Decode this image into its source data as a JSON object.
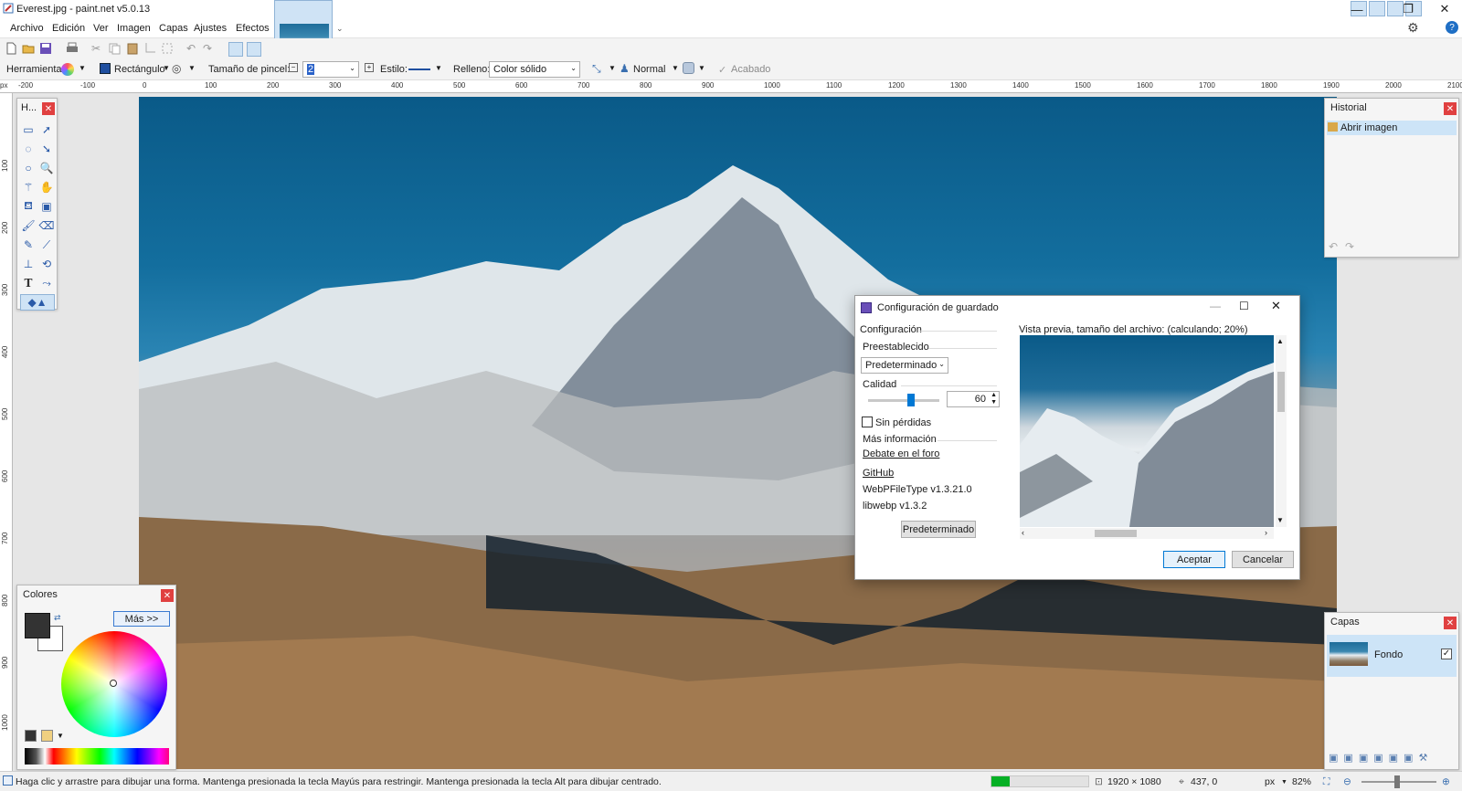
{
  "window": {
    "title": "Everest.jpg - paint.net v5.0.13"
  },
  "menu": [
    "Archivo",
    "Edición",
    "Ver",
    "Imagen",
    "Capas",
    "Ajustes",
    "Efectos"
  ],
  "toolbar": {
    "tool_label": "Herramienta:",
    "shape_label": "Rectángulo",
    "brush_size_label": "Tamaño de pincel:",
    "brush_size_value": "2",
    "style_label": "Estilo:",
    "fill_label": "Relleno:",
    "fill_value": "Color sólido",
    "blend_mode": "Normal",
    "finish_label": "Acabado"
  },
  "ruler_top": [
    "-200",
    "-100",
    "0",
    "100",
    "200",
    "300",
    "400",
    "500",
    "600",
    "700",
    "800",
    "900",
    "1000",
    "1100",
    "1200",
    "1300",
    "1400",
    "1500",
    "1600",
    "1700",
    "1800",
    "1900",
    "2000",
    "2100"
  ],
  "ruler_left": [
    "100",
    "200",
    "300",
    "400",
    "500",
    "600",
    "700",
    "800",
    "900",
    "1000"
  ],
  "tools_panel": {
    "title": "H..."
  },
  "colors_panel": {
    "title": "Colores",
    "more_button": "Más >>"
  },
  "history_panel": {
    "title": "Historial",
    "items": [
      "Abrir imagen"
    ]
  },
  "layers_panel": {
    "title": "Capas",
    "layers": [
      {
        "name": "Fondo",
        "visible": true
      }
    ]
  },
  "dialog": {
    "title": "Configuración de guardado",
    "config_heading": "Configuración",
    "preset_label": "Preestablecido",
    "preset_value": "Predeterminado",
    "quality_label": "Calidad",
    "quality_value": "60",
    "quality_fraction": 0.6,
    "lossless_label": "Sin pérdidas",
    "more_info_label": "Más información",
    "forum_link": "Debate en el foro",
    "github_link": "GitHub",
    "plugin_version": "WebPFileType v1.3.21.0",
    "lib_version": "libwebp v1.3.2",
    "default_button": "Predeterminado",
    "preview_label": "Vista previa, tamaño del archivo: (calculando; 20%)",
    "accept_button": "Aceptar",
    "cancel_button": "Cancelar"
  },
  "status": {
    "hint": "Haga clic y arrastre para dibujar una forma. Mantenga presionada la tecla Mayús para restringir. Mantenga presionada la tecla Alt para dibujar centrado.",
    "image_size": "1920 × 1080",
    "cursor_pos": "437, 0",
    "units": "px",
    "zoom": "82%"
  },
  "colors": {
    "accent": "#0078d4",
    "close_red": "#e04040"
  }
}
